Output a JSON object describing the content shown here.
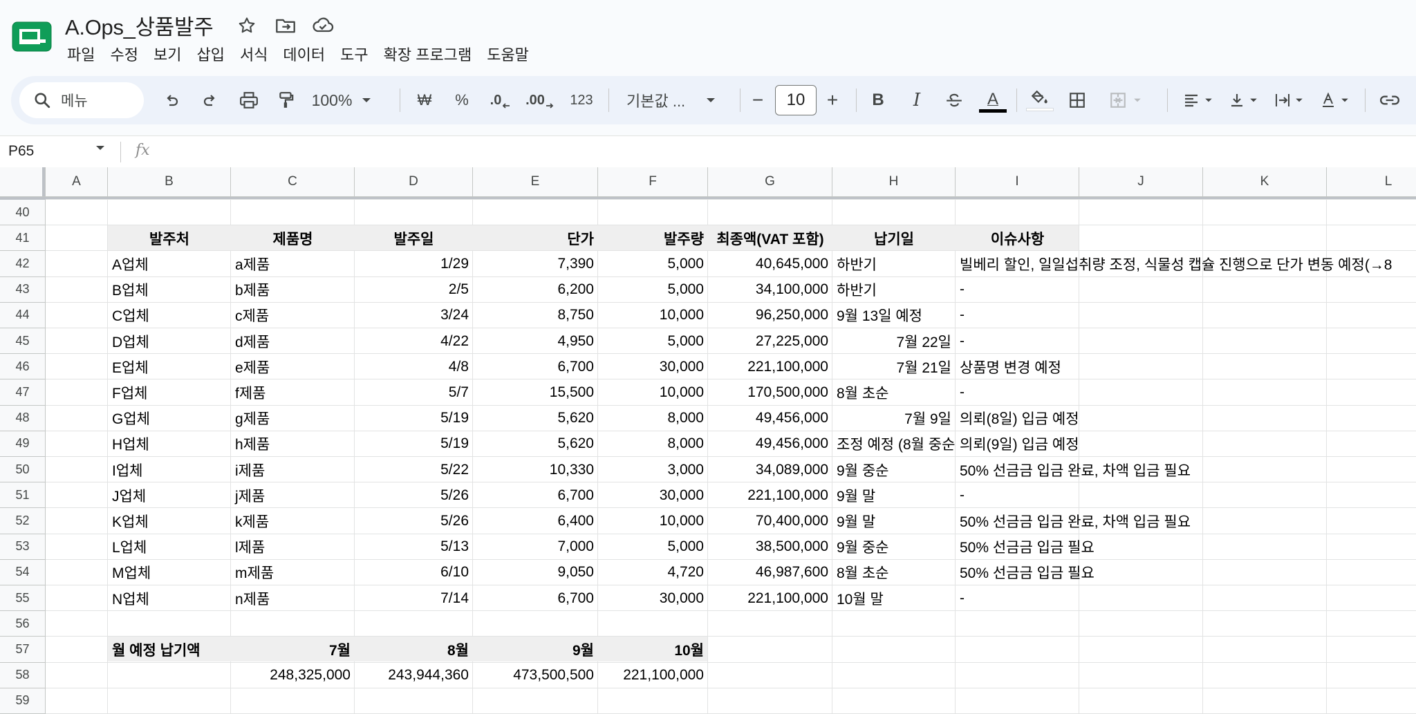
{
  "document": {
    "title": "A.Ops_상품발주"
  },
  "menu": [
    "파일",
    "수정",
    "보기",
    "삽입",
    "서식",
    "데이터",
    "도구",
    "확장 프로그램",
    "도움말"
  ],
  "toolbar": {
    "search_label": "메뉴",
    "zoom": "100%",
    "currency": "₩",
    "percent": "%",
    "decimal_decrease": ".0",
    "decimal_increase": ".00",
    "number_format": "123",
    "font_name": "기본값 ...",
    "font_size": "10",
    "minus": "−",
    "plus": "+",
    "bold": "B",
    "italic": "I",
    "text_color_letter": "A",
    "text_color": "#000000"
  },
  "formula_bar": {
    "cell_ref": "P65",
    "fx": "fx"
  },
  "grid": {
    "columns": [
      "A",
      "B",
      "C",
      "D",
      "E",
      "F",
      "G",
      "H",
      "I",
      "J",
      "K",
      "L"
    ],
    "header_row": {
      "row": "41",
      "cells": [
        "발주처",
        "제품명",
        "발주일",
        "단가",
        "발주량",
        "최종액(VAT 포함)",
        "납기일",
        "이슈사항"
      ]
    },
    "orders": [
      {
        "row": "42",
        "vendor": "A업체",
        "product": "a제품",
        "date": "1/29",
        "price": "7,390",
        "qty": "5,000",
        "total": "40,645,000",
        "due": "하반기",
        "due_align": "left",
        "issue": "빌베리 할인, 일일섭취량 조정, 식물성 캡슐 진행으로 단가 변동 예정(→8"
      },
      {
        "row": "43",
        "vendor": "B업체",
        "product": "b제품",
        "date": "2/5",
        "price": "6,200",
        "qty": "5,000",
        "total": "34,100,000",
        "due": "하반기",
        "due_align": "left",
        "issue": "-"
      },
      {
        "row": "44",
        "vendor": "C업체",
        "product": "c제품",
        "date": "3/24",
        "price": "8,750",
        "qty": "10,000",
        "total": "96,250,000",
        "due": "9월 13일 예정",
        "due_align": "left",
        "issue": "-"
      },
      {
        "row": "45",
        "vendor": "D업체",
        "product": "d제품",
        "date": "4/22",
        "price": "4,950",
        "qty": "5,000",
        "total": "27,225,000",
        "due": "7월 22일",
        "due_align": "right",
        "issue": "-"
      },
      {
        "row": "46",
        "vendor": "E업체",
        "product": "e제품",
        "date": "4/8",
        "price": "6,700",
        "qty": "30,000",
        "total": "221,100,000",
        "due": "7월 21일",
        "due_align": "right",
        "issue": "상품명 변경 예정"
      },
      {
        "row": "47",
        "vendor": "F업체",
        "product": "f제품",
        "date": "5/7",
        "price": "15,500",
        "qty": "10,000",
        "total": "170,500,000",
        "due": "8월 초순",
        "due_align": "left",
        "issue": "-"
      },
      {
        "row": "48",
        "vendor": "G업체",
        "product": "g제품",
        "date": "5/19",
        "price": "5,620",
        "qty": "8,000",
        "total": "49,456,000",
        "due": "7월 9일",
        "due_align": "right",
        "issue": "의뢰(8일) 입금 예정"
      },
      {
        "row": "49",
        "vendor": "H업체",
        "product": "h제품",
        "date": "5/19",
        "price": "5,620",
        "qty": "8,000",
        "total": "49,456,000",
        "due": "조정 예정 (8월 중순",
        "due_align": "left",
        "issue": "의뢰(9일) 입금 예정"
      },
      {
        "row": "50",
        "vendor": "I업체",
        "product": "i제품",
        "date": "5/22",
        "price": "10,330",
        "qty": "3,000",
        "total": "34,089,000",
        "due": "9월 중순",
        "due_align": "left",
        "issue": "50% 선금금 입금 완료, 차액 입금 필요"
      },
      {
        "row": "51",
        "vendor": "J업체",
        "product": "j제품",
        "date": "5/26",
        "price": "6,700",
        "qty": "30,000",
        "total": "221,100,000",
        "due": "9월 말",
        "due_align": "left",
        "issue": "-"
      },
      {
        "row": "52",
        "vendor": "K업체",
        "product": "k제품",
        "date": "5/26",
        "price": "6,400",
        "qty": "10,000",
        "total": "70,400,000",
        "due": "9월 말",
        "due_align": "left",
        "issue": "50% 선금금 입금 완료, 차액 입금 필요"
      },
      {
        "row": "53",
        "vendor": "L업체",
        "product": "l제품",
        "date": "5/13",
        "price": "7,000",
        "qty": "5,000",
        "total": "38,500,000",
        "due": "9월 중순",
        "due_align": "left",
        "issue": "50% 선금금 입금 필요"
      },
      {
        "row": "54",
        "vendor": "M업체",
        "product": "m제품",
        "date": "6/10",
        "price": "9,050",
        "qty": "4,720",
        "total": "46,987,600",
        "due": "8월 초순",
        "due_align": "left",
        "issue": "50% 선금금 입금 필요"
      },
      {
        "row": "55",
        "vendor": "N업체",
        "product": "n제품",
        "date": "7/14",
        "price": "6,700",
        "qty": "30,000",
        "total": "221,100,000",
        "due": "10월 말",
        "due_align": "left",
        "issue": "-"
      }
    ],
    "summary": {
      "label_row": "57",
      "value_row": "58",
      "label": "월 예정 납기액",
      "months": [
        "7월",
        "8월",
        "9월",
        "10월"
      ],
      "values": [
        "248,325,000",
        "243,944,360",
        "473,500,500",
        "221,100,000"
      ]
    },
    "empty_rows": [
      "40",
      "56",
      "59"
    ]
  },
  "colors": {
    "brand_green": "#0f9d58",
    "toolbar_bg": "#edf2fa",
    "header_band": "#efefef"
  }
}
